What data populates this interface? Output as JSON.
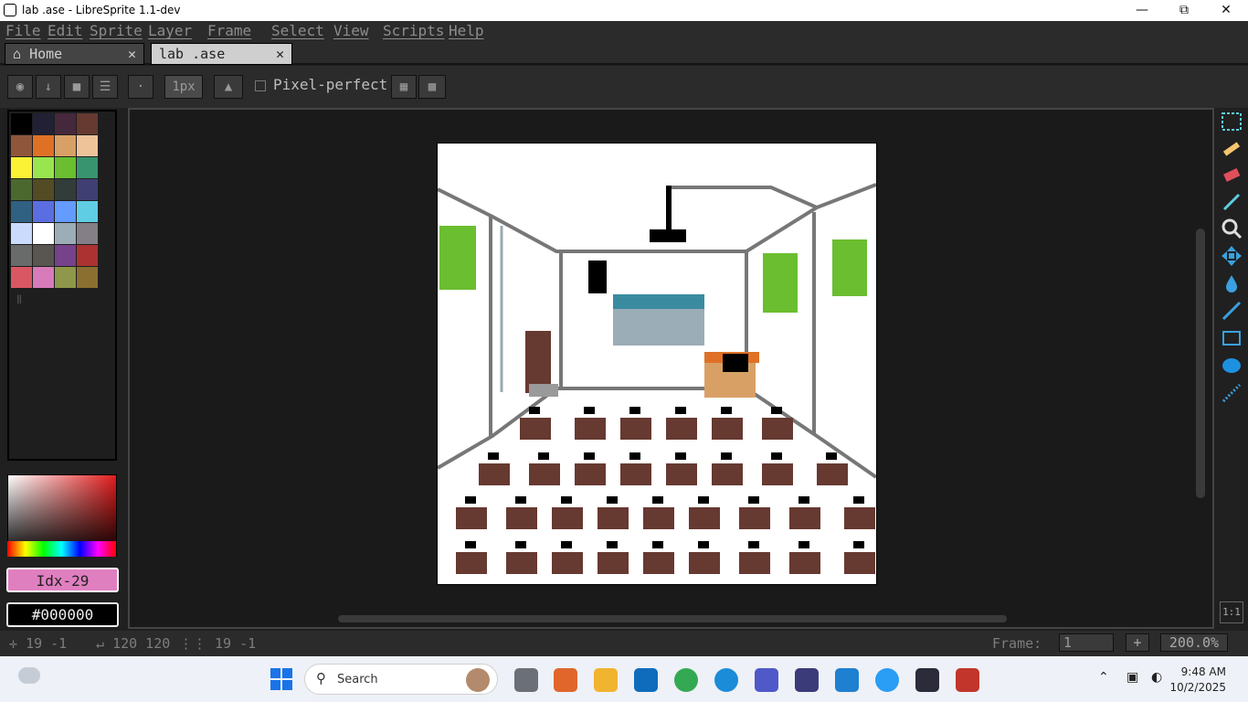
{
  "window": {
    "title": "lab .ase - LibreSprite 1.1-dev"
  },
  "menu": [
    "File",
    "Edit",
    "Sprite",
    "Layer",
    "Frame",
    "Select",
    "View",
    "Scripts",
    "Help"
  ],
  "tabs": [
    {
      "label": "Home",
      "icon": "home-icon"
    },
    {
      "label": "lab .ase"
    }
  ],
  "toolbar": {
    "brush_size": "1px",
    "pixel_perfect_label": "Pixel-perfect"
  },
  "palette": {
    "colors": [
      "#000000",
      "#222034",
      "#45283c",
      "#663931",
      "#8f563b",
      "#df7126",
      "#d9a066",
      "#eec39a",
      "#fbf236",
      "#99e550",
      "#6abe30",
      "#37946e",
      "#4b692f",
      "#524b24",
      "#323c39",
      "#3f3f74",
      "#306082",
      "#5b6ee1",
      "#639bff",
      "#5fcde4",
      "#cbdbfc",
      "#ffffff",
      "#9badb7",
      "#847e87",
      "#696a6a",
      "#595652",
      "#76428a",
      "#ac3232",
      "#d95763",
      "#d77bba",
      "#8f974a",
      "#8a6f30"
    ]
  },
  "color": {
    "index_label": "Idx-29",
    "hex": "#000000",
    "fg_color": "#d77bba"
  },
  "status": {
    "cursor": "19 -1",
    "size": "120 120",
    "grid": "19 -1",
    "frame_label": "Frame:",
    "frame_value": "1",
    "zoom": "200.0%"
  },
  "tools": [
    "marquee-icon",
    "pencil-icon",
    "eraser-icon",
    "eyedropper-icon",
    "zoom-icon",
    "move-icon",
    "paint-bucket-icon",
    "line-icon",
    "rectangle-icon",
    "ellipse-icon",
    "contour-icon"
  ],
  "corner_button": "1:1",
  "taskbar": {
    "search": "Search",
    "time": "9:48 AM",
    "date": "10/2/2025"
  }
}
